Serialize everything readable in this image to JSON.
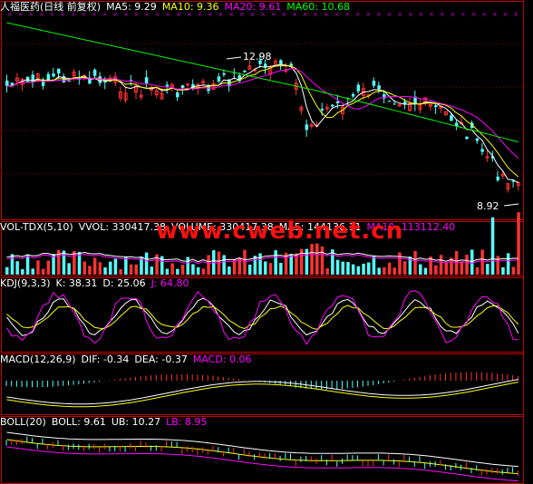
{
  "main": {
    "stock": "人福医药",
    "period": "(日线 前复权)",
    "ma5": "MA5: 9.29",
    "ma10": "MA10: 9.36",
    "ma20": "MA20: 9.61",
    "ma60": "MA60: 10.68",
    "high_price": "12.98",
    "low_price": "8.92"
  },
  "volume": {
    "title": "VOL-TDX(5,10)",
    "vvol": "VVOL: 330417.38",
    "volume": "VOLUME: 330417.38",
    "ma5": "MA5: 144136.11",
    "ma10": "MA10: 113112.40"
  },
  "kdj": {
    "title": "KDJ(9,3,3)",
    "k": "K: 38.31",
    "d": "D: 25.06",
    "j": "J: 64.80"
  },
  "macd": {
    "title": "MACD(12,26,9)",
    "dif": "DIF: -0.34",
    "dea": "DEA: -0.37",
    "macd": "MACD: 0.06"
  },
  "boll": {
    "title": "BOLL(20)",
    "boll": "BOLL: 9.61",
    "ub": "UB: 10.27",
    "lb": "LB: 8.95"
  },
  "watermark": "www.cweb.net.cn",
  "colors": {
    "up": "#ff3232",
    "down": "#54ffff",
    "ma5": "#ffffff",
    "ma10": "#ffff00",
    "ma20": "#ff00ff",
    "ma60": "#00ff00",
    "grid": "#8b0000",
    "border": "#c00000"
  }
}
